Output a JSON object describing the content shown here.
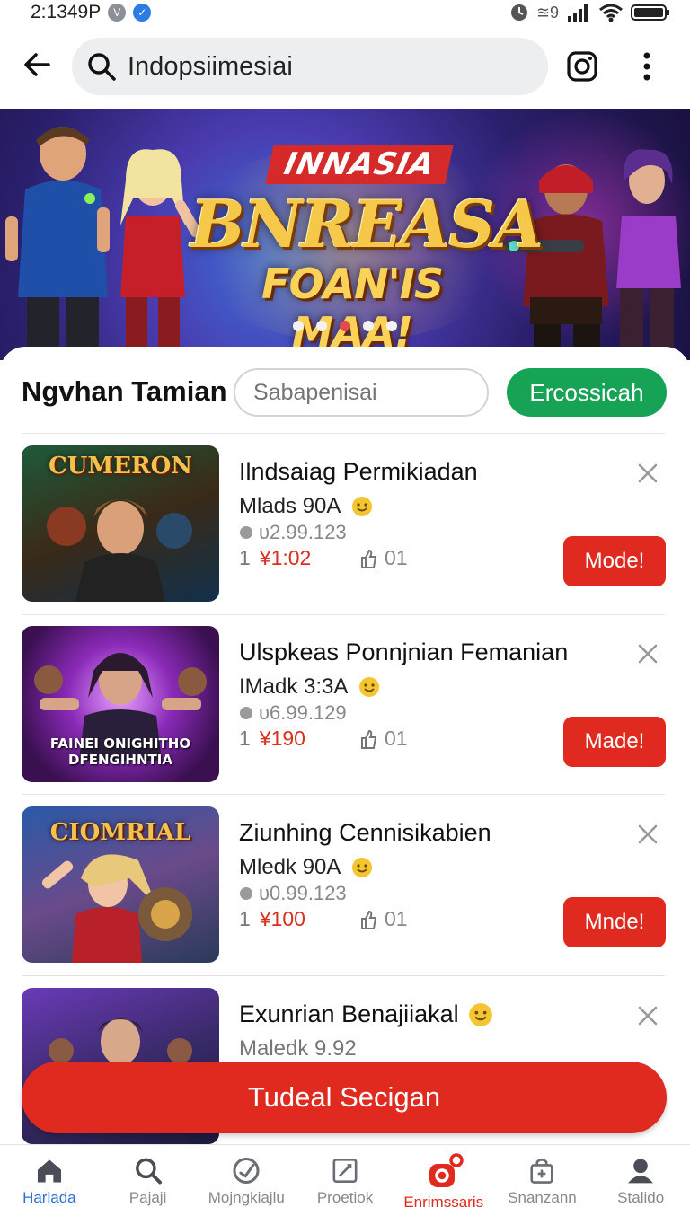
{
  "status_bar": {
    "time": "2:1349P",
    "right_text": "≊9"
  },
  "search": {
    "value": "Indopsiimesiai"
  },
  "banner": {
    "title_top": "INNASIA",
    "title_main": "BNREASA",
    "title_sub": "FOAN'IS MAA!"
  },
  "filter": {
    "title": "Ngvhan Tamian",
    "placeholder": "Sabapenisai",
    "button_label": "Ercossicah"
  },
  "items": [
    {
      "thumb_title": "CUMERON",
      "thumb_foot": "",
      "name": "Ilndsaiag Permikiadan",
      "sub": "Mlads 90A",
      "price": "υ2.99.123",
      "qty": "1",
      "cost": "¥1:02",
      "likes": "01",
      "button": "Mode!"
    },
    {
      "thumb_title": "",
      "thumb_foot": "FAINEI ONIGHITHO DFENGIHNTIA",
      "name": "Ulspkeas Ponnjnian Femanian",
      "sub": "IMadk 3:3A",
      "price": "υ6.99.129",
      "qty": "1",
      "cost": "¥190",
      "likes": "01",
      "button": "Made!"
    },
    {
      "thumb_title": "CIOMRIAL",
      "thumb_foot": "",
      "name": "Ziunhing Cennisikabien",
      "sub": "Mledk 90A",
      "price": "υ0.99.123",
      "qty": "1",
      "cost": "¥100",
      "likes": "01",
      "button": "Mnde!"
    },
    {
      "thumb_title": "",
      "thumb_foot": "",
      "name": "Exunrian Benajiiakal",
      "sub": "Maledk 9.92"
    }
  ],
  "cta": {
    "label": "Tudeal Secigan"
  },
  "bottom_nav": [
    {
      "label": "Harlada",
      "icon": "home-icon"
    },
    {
      "label": "Pajaji",
      "icon": "search-icon"
    },
    {
      "label": "Mojngkiajlu",
      "icon": "compass-icon"
    },
    {
      "label": "Proetiok",
      "icon": "edit-icon"
    },
    {
      "label": "Enrimssaris",
      "icon": "notification-icon"
    },
    {
      "label": "Snanzann",
      "icon": "bag-icon"
    },
    {
      "label": "Stalido",
      "icon": "profile-icon"
    }
  ]
}
